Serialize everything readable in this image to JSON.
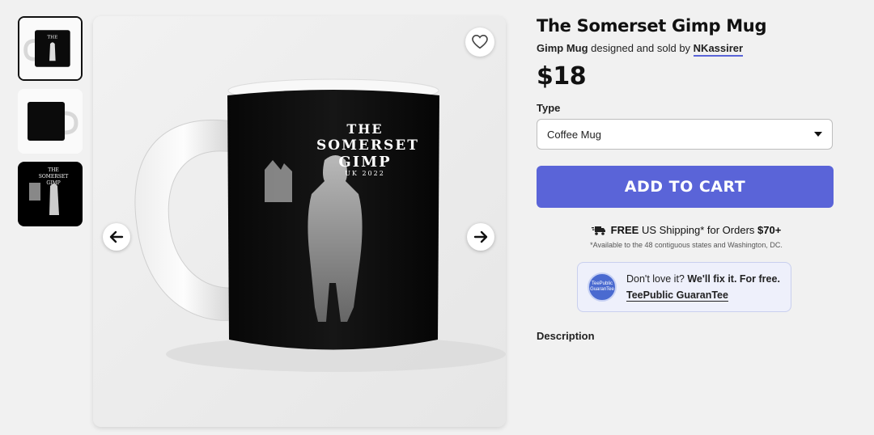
{
  "gallery": {
    "thumbnails": [
      "thumbnail-mug-front",
      "thumbnail-mug-back",
      "thumbnail-design"
    ],
    "selected_index": 0
  },
  "mug_print": {
    "line1": "THE",
    "line2": "SOMERSET",
    "line3": "GIMP",
    "line4": "UK 2022"
  },
  "product": {
    "title": "The Somerset Gimp Mug",
    "product_type_name": "Gimp Mug",
    "designed_text": "designed and sold by",
    "artist": "NKassirer",
    "price": "$18"
  },
  "type_selector": {
    "label": "Type",
    "selected": "Coffee Mug"
  },
  "cart": {
    "button_label": "ADD TO CART"
  },
  "shipping": {
    "free": "FREE",
    "text": "US Shipping* for Orders",
    "threshold": "$70+",
    "note": "*Available to the 48 contiguous states and Washington, DC."
  },
  "guarantee": {
    "seal_text": "TeePublic GuaranTee",
    "line1_plain": "Don't love it?",
    "line1_bold": "We'll fix it. For free.",
    "link": "TeePublic GuaranTee"
  },
  "description": {
    "heading": "Description"
  },
  "colors": {
    "accent": "#5a64d8",
    "mug_body": "#0b0b0b",
    "page_bg": "#f1f1f1"
  }
}
